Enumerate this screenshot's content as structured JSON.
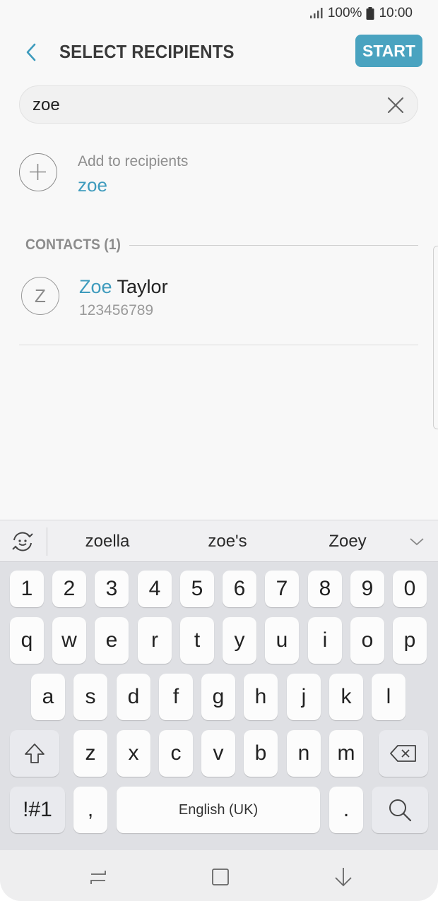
{
  "status": {
    "battery_percent": "100%",
    "time": "10:00"
  },
  "appbar": {
    "title": "SELECT RECIPIENTS",
    "start_label": "START"
  },
  "search": {
    "value": "zoe"
  },
  "add_recipient": {
    "label": "Add to recipients",
    "value": "zoe"
  },
  "contacts": {
    "header": "CONTACTS (1)",
    "items": [
      {
        "initial": "Z",
        "name_match": "Zoe",
        "name_rest": " Taylor",
        "number": "123456789"
      }
    ]
  },
  "keyboard": {
    "suggestions": [
      "zoella",
      "zoe's",
      "Zoey"
    ],
    "number_row": [
      "1",
      "2",
      "3",
      "4",
      "5",
      "6",
      "7",
      "8",
      "9",
      "0"
    ],
    "row1": [
      "q",
      "w",
      "e",
      "r",
      "t",
      "y",
      "u",
      "i",
      "o",
      "p"
    ],
    "row2": [
      "a",
      "s",
      "d",
      "f",
      "g",
      "h",
      "j",
      "k",
      "l"
    ],
    "row3": [
      "z",
      "x",
      "c",
      "v",
      "b",
      "n",
      "m"
    ],
    "symbols_label": "!#1",
    "comma": ",",
    "space_label": "English (UK)",
    "period": "."
  }
}
